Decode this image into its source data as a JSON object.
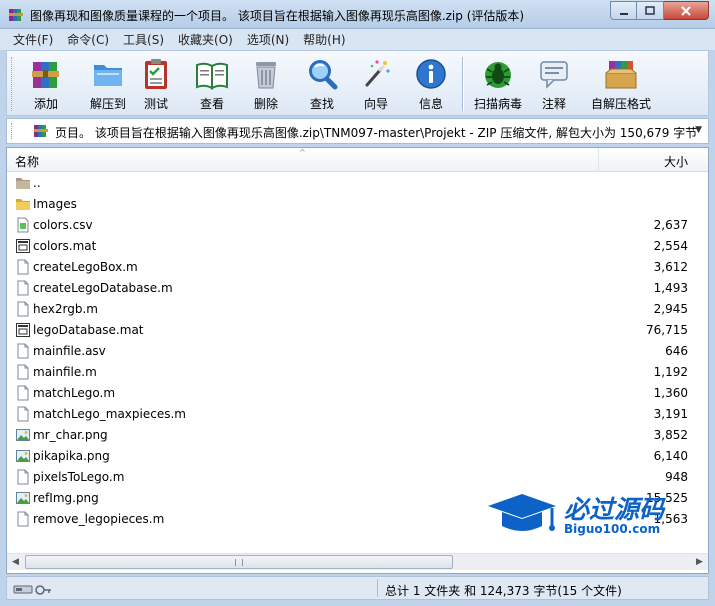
{
  "window": {
    "title": "图像再现和图像质量课程的一个项目。 该项目旨在根据输入图像再现乐高图像.zip (评估版本)"
  },
  "menu": [
    "文件(F)",
    "命令(C)",
    "工具(S)",
    "收藏夹(O)",
    "选项(N)",
    "帮助(H)"
  ],
  "toolbar": {
    "buttons": [
      {
        "label": "添加",
        "icon": "add-books-icon"
      },
      {
        "label": "解压到",
        "icon": "extract-folder-icon"
      },
      {
        "label": "测试",
        "icon": "test-clipboard-icon"
      },
      {
        "label": "查看",
        "icon": "view-book-icon"
      },
      {
        "label": "删除",
        "icon": "trash-can-icon"
      },
      {
        "label": "查找",
        "icon": "magnifier-icon"
      },
      {
        "label": "向导",
        "icon": "magic-wand-icon"
      },
      {
        "label": "信息",
        "icon": "info-icon"
      },
      {
        "label": "扫描病毒",
        "icon": "virus-scan-icon"
      },
      {
        "label": "注释",
        "icon": "comment-icon"
      },
      {
        "label": "自解压格式",
        "icon": "sfx-box-icon"
      }
    ]
  },
  "address": {
    "path": "页目。 该项目旨在根据输入图像再现乐高图像.zip\\TNM097-master\\Projekt - ZIP 压缩文件, 解包大小为 150,679 字节"
  },
  "columns": {
    "name": "名称",
    "size": "大小"
  },
  "files": [
    {
      "name": "..",
      "size": "",
      "type": "folder-up"
    },
    {
      "name": "Images",
      "size": "",
      "type": "folder"
    },
    {
      "name": "colors.csv",
      "size": "2,637",
      "type": "csv"
    },
    {
      "name": "colors.mat",
      "size": "2,554",
      "type": "mat"
    },
    {
      "name": "createLegoBox.m",
      "size": "3,612",
      "type": "m"
    },
    {
      "name": "createLegoDatabase.m",
      "size": "1,493",
      "type": "m"
    },
    {
      "name": "hex2rgb.m",
      "size": "2,945",
      "type": "m"
    },
    {
      "name": "legoDatabase.mat",
      "size": "76,715",
      "type": "mat"
    },
    {
      "name": "mainfile.asv",
      "size": "646",
      "type": "m"
    },
    {
      "name": "mainfile.m",
      "size": "1,192",
      "type": "m"
    },
    {
      "name": "matchLego.m",
      "size": "1,360",
      "type": "m"
    },
    {
      "name": "matchLego_maxpieces.m",
      "size": "3,191",
      "type": "m"
    },
    {
      "name": "mr_char.png",
      "size": "3,852",
      "type": "png"
    },
    {
      "name": "pikapika.png",
      "size": "6,140",
      "type": "png"
    },
    {
      "name": "pixelsToLego.m",
      "size": "948",
      "type": "m"
    },
    {
      "name": "refImg.png",
      "size": "15,525",
      "type": "png"
    },
    {
      "name": "remove_legopieces.m",
      "size": "1,563",
      "type": "m"
    }
  ],
  "status": {
    "text": "总计 1 文件夹 和 124,373 字节(15 个文件)"
  },
  "watermark": {
    "title": "必过源码",
    "url": "Biguo100.com"
  },
  "colors": {
    "accent": "#0c62c6",
    "selection": "#cde8ff"
  }
}
